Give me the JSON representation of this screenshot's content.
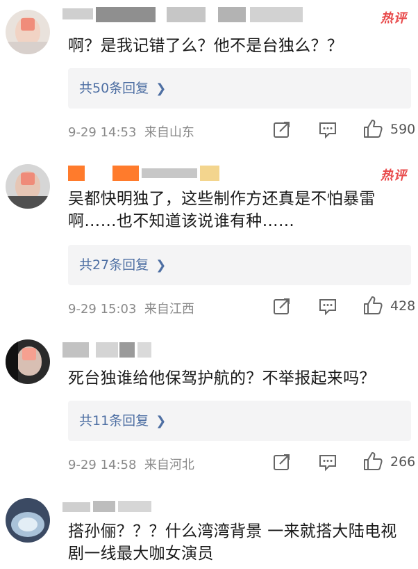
{
  "hot_label": "热评",
  "comments": [
    {
      "text": "啊？是我记错了么？他不是台独么？？",
      "reply": "共50条回复",
      "time": "9-29 14:53",
      "location": "来自山东",
      "likes": "590",
      "hot": true
    },
    {
      "text": "吴都快明独了，这些制作方还真是不怕暴雷啊……也不知道该说谁有种……",
      "reply": "共27条回复",
      "time": "9-29 15:03",
      "location": "来自江西",
      "likes": "428",
      "hot": true
    },
    {
      "text": "死台独谁给他保驾护航的？不举报起来吗？",
      "reply": "共11条回复",
      "time": "9-29 14:58",
      "location": "来自河北",
      "likes": "266",
      "hot": false
    },
    {
      "text": "搭孙俪？？？什么湾湾背景  一来就搭大陆电视剧一线最大咖女演员",
      "hot": false
    }
  ],
  "colors": {
    "hot": "#e8494a",
    "link": "#4e6fa3",
    "meta": "#8a8a8a",
    "reply_bg": "#f4f4f5"
  },
  "icons": [
    "repost-icon",
    "comment-icon",
    "like-icon",
    "chevron-right-icon"
  ]
}
